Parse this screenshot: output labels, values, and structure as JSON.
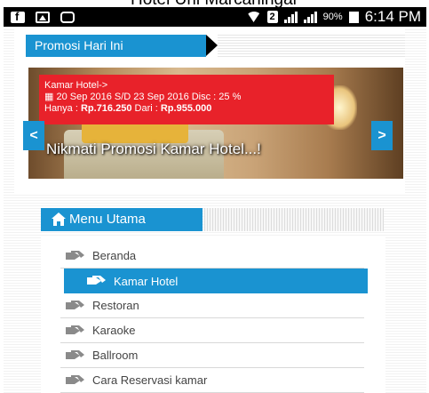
{
  "caption": "Hotel Uril Marcaningar",
  "statusbar": {
    "battery_pct": "90%",
    "time": "6:14 PM",
    "badge": "2"
  },
  "promo": {
    "ribbon_label": "Promosi Hari Ini",
    "line1": "Kamar Hotel->",
    "line2": "20 Sep 2016 S/D 23 Sep 2016 Disc : 25 %",
    "line3_prefix": "Hanya : ",
    "price_now": "Rp.716.250",
    "line3_mid": " Dari : ",
    "price_was": "Rp.955.000",
    "slide_title": "Nikmati Promosi Kamar Hotel...!",
    "prev": "<",
    "next": ">"
  },
  "menu": {
    "title": "Menu Utama",
    "items": [
      {
        "label": "Beranda"
      },
      {
        "label": "Kamar Hotel"
      },
      {
        "label": "Restoran"
      },
      {
        "label": "Karaoke"
      },
      {
        "label": "Ballroom"
      },
      {
        "label": "Cara Reservasi kamar"
      }
    ]
  },
  "colors": {
    "accent": "#1a93d1",
    "promo": "#e8222a"
  }
}
